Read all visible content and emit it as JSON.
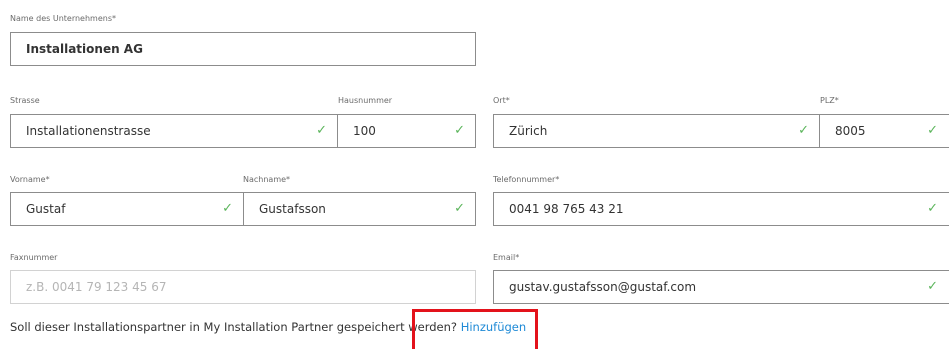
{
  "form": {
    "company": {
      "label": "Name des Unternehmens*",
      "value": "Installationen AG"
    },
    "street": {
      "label": "Strasse",
      "value": "Installationenstrasse"
    },
    "house_number": {
      "label": "Hausnummer",
      "value": "100"
    },
    "city": {
      "label": "Ort*",
      "value": "Zürich"
    },
    "zip": {
      "label": "PLZ*",
      "value": "8005"
    },
    "first_name": {
      "label": "Vorname*",
      "value": "Gustaf"
    },
    "last_name": {
      "label": "Nachname*",
      "value": "Gustafsson"
    },
    "phone": {
      "label": "Telefonnummer*",
      "value": "0041 98 765 43 21"
    },
    "fax": {
      "label": "Faxnummer",
      "value": "",
      "placeholder": "z.B. 0041 79 123 45 67"
    },
    "email": {
      "label": "Email*",
      "value": "gustav.gustafsson@gustaf.com"
    }
  },
  "save_prompt": {
    "text": "Soll dieser Installationspartner in My Installation Partner gespeichert werden?",
    "link": "Hinzufügen"
  },
  "icons": {
    "valid": "check-icon"
  },
  "colors": {
    "valid": "#5bb55b",
    "link": "#1f8ad6",
    "highlight": "#e3121b"
  }
}
